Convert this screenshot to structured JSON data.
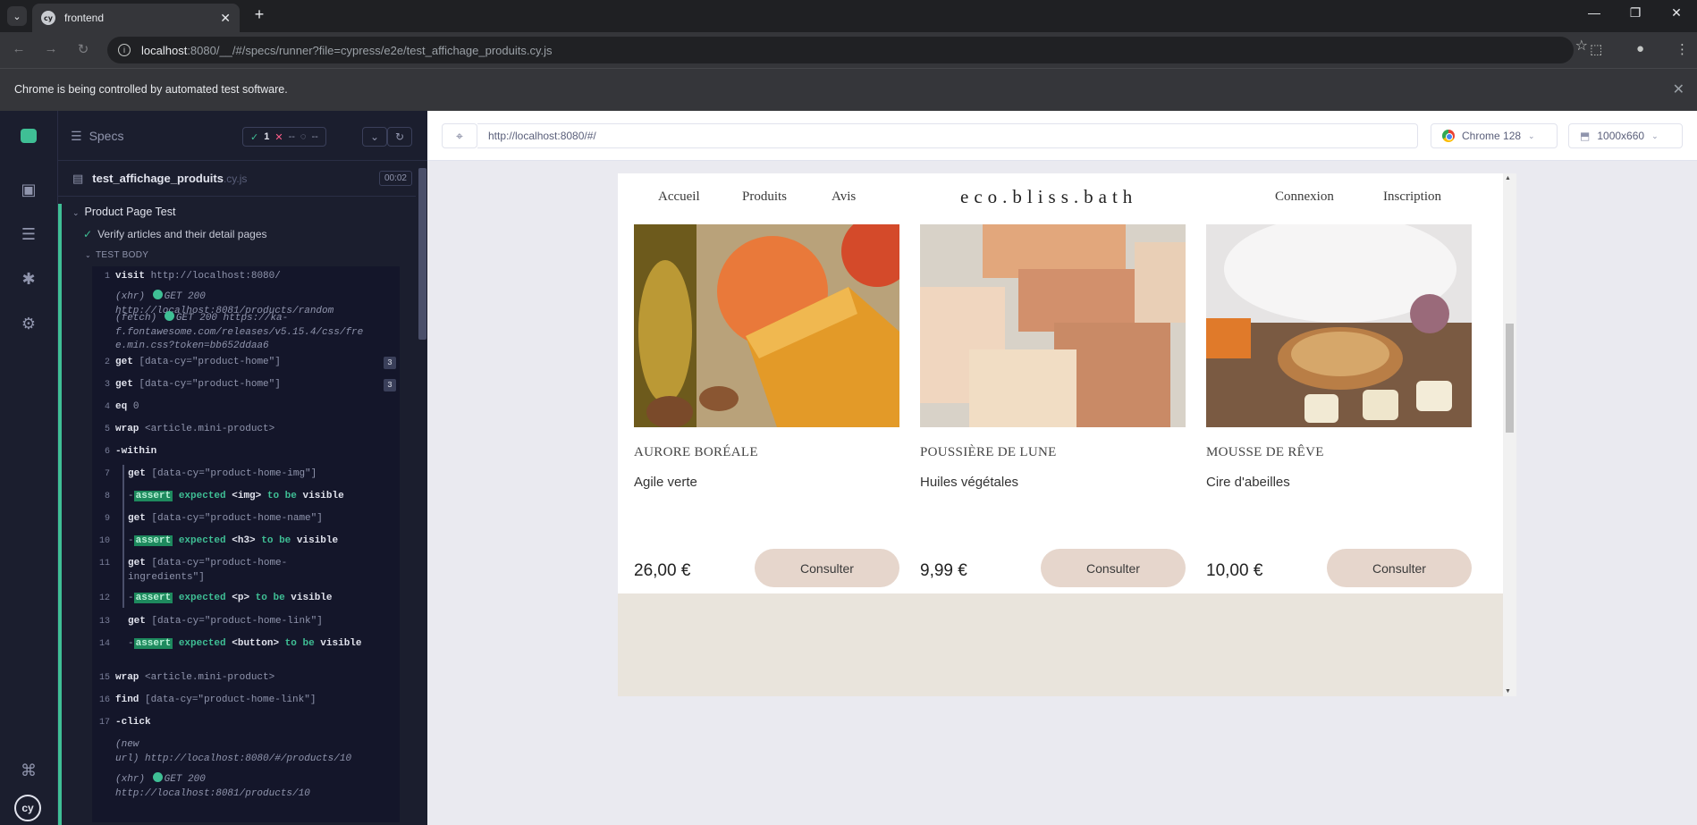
{
  "browser": {
    "tab_title": "frontend",
    "favicon_text": "cy",
    "url_host": "localhost",
    "url_rest": ":8080/__/#/specs/runner?file=cypress/e2e/test_affichage_produits.cy.js",
    "infobar_message": "Chrome is being controlled by automated test software."
  },
  "reporter": {
    "header_label": "Specs",
    "passed": "1",
    "failed": "--",
    "pending": "--",
    "file_name": "test_affichage_produits",
    "file_ext": ".cy.js",
    "duration": "00:02",
    "suite_title": "Product Page Test",
    "test_title": "Verify articles and their detail pages",
    "test_body_label": "TEST BODY",
    "commands": [
      {
        "num": "1",
        "name": "visit",
        "arg": "http://localhost:8080/"
      },
      {
        "num": "",
        "name": "(xhr)",
        "arg": "GET 200",
        "arg2": "http://localhost:8081/products/random"
      },
      {
        "num": "",
        "name": "(fetch)",
        "arg": "GET 200 https://ka-",
        "arg2": "f.fontawesome.com/releases/v5.15.4/css/fre",
        "arg3": "e.min.css?token=bb652ddaa6"
      },
      {
        "num": "2",
        "name": "get",
        "arg": "[data-cy=\"product-home\"]",
        "count": "3"
      },
      {
        "num": "3",
        "name": "get",
        "arg": "[data-cy=\"product-home\"]",
        "count": "3"
      },
      {
        "num": "4",
        "name": "eq",
        "arg": "0"
      },
      {
        "num": "5",
        "name": "wrap",
        "arg": "<article.mini-product>"
      },
      {
        "num": "6",
        "name": "-within",
        "arg": ""
      },
      {
        "num": "7",
        "name": "get",
        "arg": "[data-cy=\"product-home-img\"]"
      },
      {
        "num": "8",
        "name": "assert",
        "arg": "expected",
        "tag": "<img>",
        "tail": "to be",
        "tail2": "visible"
      },
      {
        "num": "9",
        "name": "get",
        "arg": "[data-cy=\"product-home-name\"]"
      },
      {
        "num": "10",
        "name": "assert",
        "arg": "expected",
        "tag": "<h3>",
        "tail": "to be",
        "tail2": "visible"
      },
      {
        "num": "11",
        "name": "get",
        "arg": "[data-cy=\"product-home-",
        "arg2": "ingredients\"]"
      },
      {
        "num": "12",
        "name": "assert",
        "arg": "expected",
        "tag": "<p>",
        "tail": "to be",
        "tail2": "visible"
      },
      {
        "num": "13",
        "name": "get",
        "arg": "[data-cy=\"product-home-link\"]"
      },
      {
        "num": "14",
        "name": "assert",
        "arg": "expected",
        "tag": "<button>",
        "tail": "to be",
        "tail2": "visible"
      },
      {
        "num": "15",
        "name": "wrap",
        "arg": "<article.mini-product>"
      },
      {
        "num": "16",
        "name": "find",
        "arg": "[data-cy=\"product-home-link\"]"
      },
      {
        "num": "17",
        "name": "-click",
        "arg": ""
      },
      {
        "num": "",
        "name": "(new",
        "name2": "url)",
        "arg": "http://localhost:8080/#/products/10"
      },
      {
        "num": "",
        "name": "(xhr)",
        "arg": "GET 200",
        "arg2": "http://localhost:8081/products/10"
      }
    ]
  },
  "aut": {
    "url": "http://localhost:8080/#/",
    "browser_name": "Chrome 128",
    "viewport": "1000x660"
  },
  "site": {
    "nav_left": [
      "Accueil",
      "Produits",
      "Avis"
    ],
    "brand": "eco.bliss.bath",
    "nav_right": [
      "Connexion",
      "Inscription"
    ],
    "products": [
      {
        "name": "AURORE BORÉALE",
        "ingredients": "Agile verte",
        "price": "26,00 €",
        "button": "Consulter"
      },
      {
        "name": "POUSSIÈRE DE LUNE",
        "ingredients": "Huiles végétales",
        "price": "9,99 €",
        "button": "Consulter"
      },
      {
        "name": "MOUSSE DE RÊVE",
        "ingredients": "Cire d'abeilles",
        "price": "10,00 €",
        "button": "Consulter"
      }
    ]
  }
}
